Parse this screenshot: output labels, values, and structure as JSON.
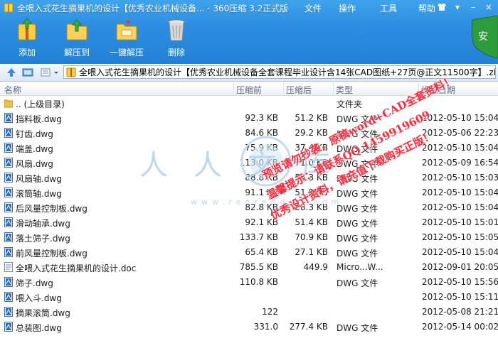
{
  "window": {
    "title": "全喂入式花生摘果机的设计【优秀农业机械设备... - 360压缩 3.2正式版",
    "menu": [
      "文件",
      "操作",
      "工具",
      "帮助"
    ]
  },
  "toolbar": {
    "add_label": "添加",
    "extract_label": "解压到",
    "one_click_label": "一键解压",
    "delete_label": "删除"
  },
  "address": {
    "path": "全喂入式花生摘果机的设计【优秀农业机械设备全套课程毕业设计含14张CAD图纸+27页@正文11500字】.zi"
  },
  "columns": {
    "name": "名称",
    "size": "压缩前",
    "packed": "压缩后",
    "type": "类型",
    "modified": "修改日期"
  },
  "files": [
    {
      "name": ".. (上级目录)",
      "size": "",
      "packed": "",
      "type": "文件夹",
      "date": "",
      "icon": "folder-icon"
    },
    {
      "name": "挡料板.dwg",
      "size": "92.3 KB",
      "packed": "51.2 KB",
      "type": "DWG 文件",
      "date": "2012-05-10 15:04",
      "icon": "dwg-file-icon"
    },
    {
      "name": "钉齿.dwg",
      "size": "84.6 KB",
      "packed": "29.2 KB",
      "type": "DWG 文件",
      "date": "2012-05-06 22:23",
      "icon": "dwg-file-icon"
    },
    {
      "name": "端盖.dwg",
      "size": "75.9 KB",
      "packed": "37.4 KB",
      "type": "DWG 文件",
      "date": "2012-05-10 15:04",
      "icon": "dwg-file-icon"
    },
    {
      "name": "风扇.dwg",
      "size": "113.0 KB",
      "packed": "71.0 KB",
      "type": "DWG 文件",
      "date": "2012-05-09 16:54",
      "icon": "dwg-file-icon"
    },
    {
      "name": "风扇轴.dwg",
      "size": "88.8 KB",
      "packed": "50.3 KB",
      "type": "DWG 文件",
      "date": "2012-05-10 15:03",
      "icon": "dwg-file-icon"
    },
    {
      "name": "滚筒轴.dwg",
      "size": "91.1 KB",
      "packed": "51.8 KB",
      "type": "DWG 文件",
      "date": "2012-05-10 15:04",
      "icon": "dwg-file-icon"
    },
    {
      "name": "后风量控制板.dwg",
      "size": "82.8 KB",
      "packed": "28.3 KB",
      "type": "DWG 文件",
      "date": "2012-05-10 15:04",
      "icon": "dwg-file-icon"
    },
    {
      "name": "滑动轴承.dwg",
      "size": "92.1 KB",
      "packed": "51.4 KB",
      "type": "DWG 文件",
      "date": "2012-05-10 15:01",
      "icon": "dwg-file-icon"
    },
    {
      "name": "落土筛子.dwg",
      "size": "133.7 KB",
      "packed": "70.9 KB",
      "type": "DWG 文件",
      "date": "2012-05-10 15:05",
      "icon": "dwg-file-icon"
    },
    {
      "name": "前风量控制板.dwg",
      "size": "65.4 KB",
      "packed": "27.1 KB",
      "type": "DWG 文件",
      "date": "2012-05-10 15:04",
      "icon": "dwg-file-icon"
    },
    {
      "name": "全喂入式花生摘果机的设计.doc",
      "size": "785.5 KB",
      "packed": "449.9",
      "type": "Micro...W...",
      "date": "2012-09-01 20:05",
      "icon": "doc-file-icon"
    },
    {
      "name": "筛子.dwg",
      "size": "110.8 KB",
      "packed": "",
      "type": "DWG 文件",
      "date": "2012-05-10 15:56",
      "icon": "dwg-file-icon"
    },
    {
      "name": "喂入斗.dwg",
      "size": "",
      "packed": "",
      "type": "",
      "date": "2012-05-10 15:11",
      "icon": "dwg-file-icon"
    },
    {
      "name": "摘果滚筒.dwg",
      "size": "122",
      "packed": "",
      "type": "",
      "date": "2012-05-08 21:21",
      "icon": "dwg-file-icon"
    },
    {
      "name": "总装图.dwg",
      "size": "331.0",
      "packed": "277.4 KB",
      "type": "DWG 文件",
      "date": "2012-05-14 00:02",
      "icon": "dwg-file-icon"
    }
  ],
  "watermark": {
    "logo_chars": "人人文库",
    "url": "www.renrendoc.com",
    "stamp_lines": [
      "预览请勿抄袭，原稿word+CAD全套资料！",
      "温馨提示：请联系QQ 1459919609",
      "优秀设计资料，请充值下载购买正版！"
    ]
  },
  "colors": {
    "toolbar_blue": "#2d8ee0",
    "stamp_red": "#ff2a3c",
    "shield_green": "#2e9b3c"
  }
}
